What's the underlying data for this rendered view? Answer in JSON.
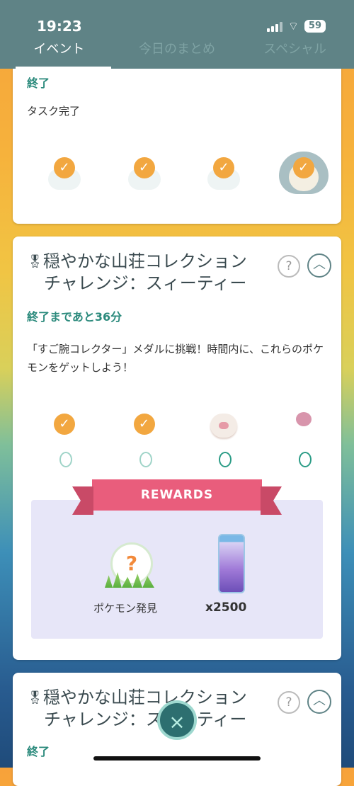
{
  "status_bar": {
    "time": "19:23",
    "battery": "59"
  },
  "tabs": [
    {
      "label": "イベント",
      "active": true
    },
    {
      "label": "今日のまとめ",
      "active": false
    },
    {
      "label": "スペシャル",
      "active": false
    }
  ],
  "card1": {
    "status": "終了",
    "task_label": "タスク完了",
    "pokemon": [
      {
        "caught": true,
        "icon": "pokemon-silhouette-icon"
      },
      {
        "caught": true,
        "icon": "pokemon-silhouette-icon"
      },
      {
        "caught": true,
        "icon": "pokemon-silhouette-icon"
      },
      {
        "caught": true,
        "icon": "snorlax-icon"
      }
    ]
  },
  "card2": {
    "title_line1": "穏やかな山荘コレクション",
    "title_line2": "チャレンジ：スィーティー",
    "status": "終了まであと36分",
    "description": "「すご腕コレクター」メダルに挑戦！時間内に、これらのポケモンをゲットしよう！",
    "help": "?",
    "collapse": "︿",
    "pokemon": [
      {
        "caught": true,
        "icon": "egg-outline-icon"
      },
      {
        "caught": true,
        "icon": "egg-outline-icon"
      },
      {
        "caught": false,
        "icon": "swirlix-icon"
      },
      {
        "caught": false,
        "icon": "spritzee-icon"
      }
    ],
    "rewards_title": "REWARDS",
    "rewards": [
      {
        "label": "ポケモン発見",
        "icon": "question-encounter-icon"
      },
      {
        "amount": "x2500",
        "icon": "stardust-bottle-icon"
      }
    ]
  },
  "card3": {
    "title_line1": "穏やかな山荘コレクション",
    "title_line2": "チャレンジ：スィーティー",
    "status": "終了",
    "help": "?",
    "collapse": "︿"
  },
  "fab": {
    "icon": "close-icon",
    "glyph": "×"
  },
  "colors": {
    "accent": "#2b8a7c",
    "topbar": "#5f8386",
    "ribbon": "#e95d7c",
    "check": "#f2a740"
  }
}
